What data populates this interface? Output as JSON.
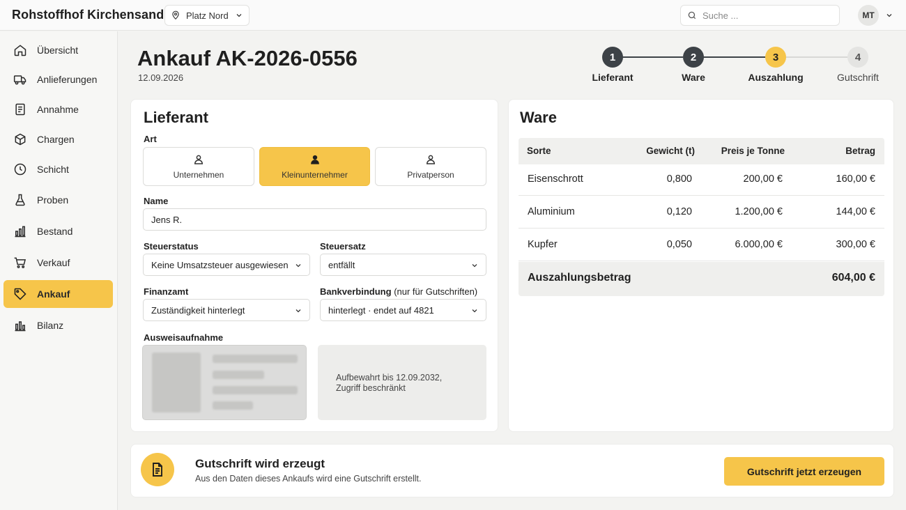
{
  "app": {
    "brand": "Rohstoffhof Kirchensand",
    "location": "Platz Nord",
    "search_placeholder": "Suche ...",
    "user_initials": "MT"
  },
  "sidebar": {
    "items": [
      {
        "label": "Übersicht",
        "icon": "home-icon"
      },
      {
        "label": "Anlieferungen",
        "icon": "truck-icon"
      },
      {
        "label": "Annahme",
        "icon": "document-icon"
      },
      {
        "label": "Chargen",
        "icon": "box-icon"
      },
      {
        "label": "Schicht",
        "icon": "clock-icon"
      },
      {
        "label": "Proben",
        "icon": "flask-icon"
      },
      {
        "label": "Bestand",
        "icon": "bar-chart-icon"
      },
      {
        "label": "Verkauf",
        "icon": "cart-icon"
      },
      {
        "label": "Ankauf",
        "icon": "tag-icon",
        "active": true
      },
      {
        "label": "Bilanz",
        "icon": "bar-chart-icon"
      }
    ]
  },
  "header": {
    "title": "Ankauf AK-2026-0556",
    "date": "12.09.2026"
  },
  "stepper": {
    "steps": [
      {
        "num": "1",
        "label": "Lieferant",
        "state": "done"
      },
      {
        "num": "2",
        "label": "Ware",
        "state": "done"
      },
      {
        "num": "3",
        "label": "Auszahlung",
        "state": "current"
      },
      {
        "num": "4",
        "label": "Gutschrift",
        "state": "pending"
      }
    ]
  },
  "supplier": {
    "title": "Lieferant",
    "art_label": "Art",
    "art_options": [
      "Unternehmen",
      "Kleinunternehmer",
      "Privatperson"
    ],
    "art_selected": "Kleinunternehmer",
    "name_label": "Name",
    "name_value": "Jens R.",
    "tax_status_label": "Steuerstatus",
    "tax_status_value": "Keine Umsatzsteuer ausgewiesen",
    "tax_rate_label": "Steuersatz",
    "tax_rate_value": "entfällt",
    "tax_office_label": "Finanzamt",
    "tax_office_value": "Zuständigkeit hinterlegt",
    "bank_label": "Bankverbindung",
    "bank_label_note": "(nur für Gutschriften)",
    "bank_value": "hinterlegt · endet auf 4821",
    "id_label": "Ausweisaufnahme",
    "id_note_line1": "Aufbewahrt bis 12.09.2032,",
    "id_note_line2": "Zugriff beschränkt"
  },
  "goods": {
    "title": "Ware",
    "columns": [
      "Sorte",
      "Gewicht (t)",
      "Preis je Tonne",
      "Betrag"
    ],
    "rows": [
      [
        "Eisenschrott",
        "0,800",
        "200,00 €",
        "160,00 €"
      ],
      [
        "Aluminium",
        "0,120",
        "1.200,00 €",
        "144,00 €"
      ],
      [
        "Kupfer",
        "0,050",
        "6.000,00 €",
        "300,00 €"
      ]
    ],
    "total_label": "Auszahlungsbetrag",
    "total_value": "604,00 €"
  },
  "banner": {
    "title": "Gutschrift wird erzeugt",
    "subtitle": "Aus den Daten dieses Ankaufs wird eine Gutschrift erstellt.",
    "button_label": "Gutschrift jetzt erzeugen"
  },
  "colors": {
    "accent": "#f6c54a",
    "step_done": "#3d4247",
    "step_pending": "#e4e4e2"
  }
}
